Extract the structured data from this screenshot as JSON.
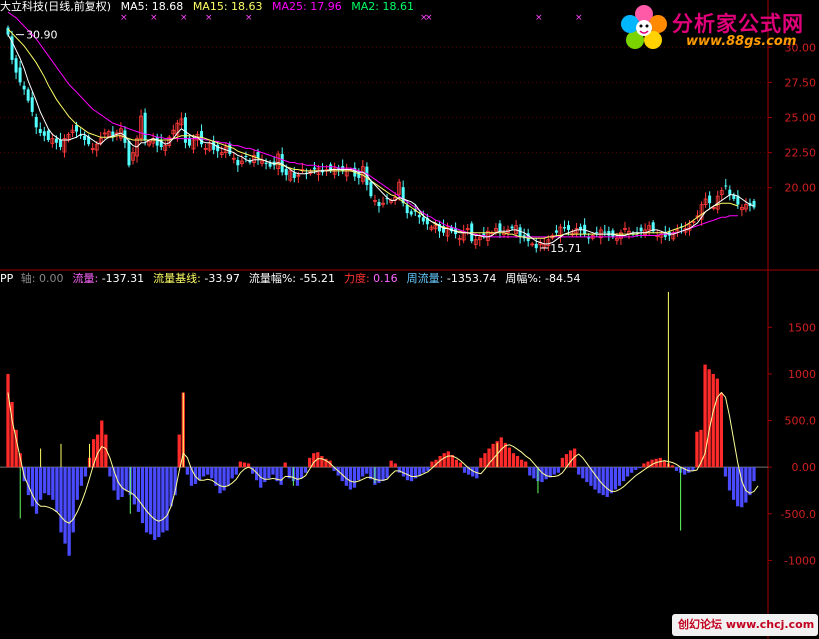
{
  "chart_data": [
    {
      "type": "candlestick",
      "title": "大立科技(日线,前复权)",
      "indicators": [
        {
          "name": "MA5",
          "label": "MA5: 18.68",
          "value": 18.68,
          "color": "#ffffff"
        },
        {
          "name": "MA15",
          "label": "MA15: 18.63",
          "value": 18.63,
          "color": "#ffff66"
        },
        {
          "name": "MA25",
          "label": "MA25: 17.96",
          "value": 17.96,
          "color": "#ff00ff"
        },
        {
          "name": "MA2",
          "label": "MA2: 18.61",
          "value": 18.61,
          "color": "#00ff66"
        }
      ],
      "y_ticks": [
        "30.00",
        "27.50",
        "25.00",
        "22.50",
        "20.00"
      ],
      "ylim": [
        14.5,
        31.8
      ],
      "annotations": [
        {
          "text": "30.90",
          "x": 2,
          "y": 30.9
        },
        {
          "text": "15.71",
          "x": 132,
          "y": 15.71
        }
      ],
      "close": [
        30.9,
        29.1,
        28.2,
        27.5,
        27.0,
        26.2,
        25.4,
        24.3,
        23.9,
        23.7,
        23.4,
        23.5,
        23.2,
        22.9,
        23.5,
        23.8,
        24.1,
        24.0,
        23.7,
        23.4,
        23.1,
        22.8,
        23.1,
        23.5,
        23.9,
        24.0,
        23.6,
        23.9,
        24.2,
        23.2,
        21.6,
        22.5,
        23.5,
        25.1,
        23.4,
        23.3,
        23.5,
        23.0,
        22.9,
        23.0,
        23.6,
        24.1,
        24.6,
        24.9,
        23.2,
        23.0,
        23.4,
        23.8,
        23.1,
        22.8,
        23.2,
        22.7,
        22.6,
        22.5,
        22.9,
        22.4,
        22.1,
        21.6,
        21.9,
        22.2,
        21.8,
        22.3,
        22.1,
        21.9,
        21.7,
        21.5,
        21.6,
        22.4,
        21.1,
        20.9,
        21.2,
        20.7,
        20.9,
        21.3,
        21.0,
        21.2,
        21.3,
        21.4,
        21.1,
        21.3,
        21.2,
        21.4,
        21.3,
        21.2,
        21.4,
        21.3,
        20.8,
        20.7,
        21.5,
        20.2,
        19.4,
        19.1,
        18.7,
        18.9,
        19.2,
        19.1,
        19.3,
        20.4,
        18.9,
        18.2,
        18.1,
        18.3,
        17.9,
        17.6,
        17.4,
        17.2,
        17.3,
        16.9,
        16.8,
        17.2,
        16.9,
        16.7,
        16.4,
        16.9,
        17.1,
        16.2,
        16.3,
        16.5,
        16.6,
        16.9,
        16.8,
        17.1,
        16.9,
        16.8,
        17.0,
        17.1,
        17.3,
        16.5,
        16.4,
        16.2,
        16.0,
        15.7,
        16.1,
        16.0,
        16.3,
        16.6,
        16.8,
        17.2,
        17.1,
        17.0,
        16.9,
        17.1,
        17.0,
        16.7,
        16.4,
        16.6,
        16.8,
        17.0,
        16.8,
        16.6,
        16.5,
        16.4,
        16.8,
        17.1,
        16.9,
        16.7,
        16.8,
        16.9,
        17.0,
        17.3,
        16.9,
        16.6,
        16.7,
        16.5,
        16.6,
        16.8,
        17.0,
        17.2,
        17.1,
        17.4,
        17.6,
        18.0,
        18.8,
        19.2,
        18.9,
        18.6,
        19.4,
        19.8,
        20.1,
        19.5,
        19.2,
        18.8,
        18.6,
        18.8,
        18.7,
        18.6
      ],
      "ma5": [
        30.9,
        30.4,
        29.8,
        29.2,
        28.5,
        27.6,
        26.9,
        26.2,
        25.4,
        24.8,
        24.2,
        23.8,
        23.6,
        23.4,
        23.4,
        23.4,
        23.5,
        23.6,
        23.8,
        23.8,
        23.6,
        23.4,
        23.2,
        23.1,
        23.4,
        23.6,
        23.7,
        23.8,
        23.9,
        23.7,
        23.3,
        23.0,
        22.9,
        23.2,
        23.2,
        23.4,
        23.5,
        23.4,
        23.3,
        23.1,
        23.2,
        23.5,
        23.9,
        24.2,
        24.0,
        23.8,
        23.6,
        23.6,
        23.3,
        23.2,
        23.2,
        23.1,
        22.9,
        22.8,
        22.7,
        22.6,
        22.5,
        22.3,
        22.2,
        22.0,
        21.9,
        22.0,
        22.0,
        22.0,
        21.9,
        21.8,
        21.7,
        21.8,
        21.7,
        21.5,
        21.3,
        21.1,
        21.0,
        21.0,
        21.0,
        21.1,
        21.1,
        21.2,
        21.2,
        21.2,
        21.3,
        21.3,
        21.3,
        21.3,
        21.3,
        21.3,
        21.2,
        21.1,
        21.1,
        20.9,
        20.5,
        20.2,
        19.9,
        19.6,
        19.3,
        19.1,
        19.1,
        19.3,
        19.2,
        19.1,
        19.0,
        18.8,
        18.4,
        18.0,
        17.8,
        17.6,
        17.5,
        17.3,
        17.1,
        17.1,
        17.0,
        16.9,
        16.8,
        16.8,
        16.8,
        16.7,
        16.6,
        16.6,
        16.5,
        16.5,
        16.6,
        16.8,
        16.9,
        16.9,
        16.9,
        17.0,
        17.0,
        16.9,
        16.8,
        16.6,
        16.4,
        16.2,
        16.1,
        16.0,
        16.0,
        16.1,
        16.3,
        16.5,
        16.7,
        16.8,
        16.9,
        17.0,
        17.0,
        17.0,
        16.9,
        16.8,
        16.7,
        16.7,
        16.7,
        16.7,
        16.7,
        16.6,
        16.6,
        16.6,
        16.7,
        16.8,
        16.8,
        16.8,
        16.8,
        16.9,
        17.0,
        17.0,
        16.9,
        16.8,
        16.7,
        16.7,
        16.8,
        16.9,
        17.0,
        17.1,
        17.3,
        17.5,
        17.9,
        18.3,
        18.5,
        18.7,
        18.9,
        19.1,
        19.3,
        19.5,
        19.5,
        19.4,
        19.2,
        19.0,
        18.8,
        18.7
      ],
      "ma15": [
        31.3,
        31.0,
        30.7,
        30.4,
        30.1,
        29.7,
        29.3,
        28.9,
        28.4,
        27.9,
        27.3,
        26.8,
        26.3,
        25.9,
        25.5,
        25.1,
        24.8,
        24.5,
        24.3,
        24.1,
        23.9,
        23.8,
        23.7,
        23.6,
        23.6,
        23.6,
        23.6,
        23.7,
        23.7,
        23.6,
        23.5,
        23.4,
        23.4,
        23.4,
        23.4,
        23.4,
        23.4,
        23.4,
        23.4,
        23.4,
        23.4,
        23.5,
        23.6,
        23.7,
        23.7,
        23.7,
        23.7,
        23.6,
        23.6,
        23.5,
        23.4,
        23.3,
        23.2,
        23.1,
        23.0,
        22.9,
        22.8,
        22.6,
        22.5,
        22.4,
        22.3,
        22.2,
        22.1,
        22.0,
        21.9,
        21.8,
        21.7,
        21.7,
        21.6,
        21.5,
        21.4,
        21.3,
        21.3,
        21.2,
        21.2,
        21.2,
        21.2,
        21.2,
        21.2,
        21.2,
        21.2,
        21.2,
        21.2,
        21.2,
        21.2,
        21.2,
        21.1,
        21.0,
        20.9,
        20.7,
        20.5,
        20.3,
        20.1,
        19.9,
        19.7,
        19.5,
        19.4,
        19.2,
        19.0,
        18.8,
        18.6,
        18.4,
        18.2,
        18.0,
        17.8,
        17.6,
        17.4,
        17.3,
        17.2,
        17.1,
        17.0,
        16.9,
        16.9,
        16.8,
        16.8,
        16.8,
        16.8,
        16.8,
        16.8,
        16.8,
        16.8,
        16.8,
        16.8,
        16.8,
        16.7,
        16.7,
        16.6,
        16.5,
        16.5,
        16.4,
        16.4,
        16.4,
        16.4,
        16.4,
        16.5,
        16.5,
        16.6,
        16.6,
        16.7,
        16.7,
        16.7,
        16.7,
        16.7,
        16.7,
        16.7,
        16.7,
        16.7,
        16.7,
        16.7,
        16.7,
        16.7,
        16.7,
        16.7,
        16.7,
        16.7,
        16.7,
        16.7,
        16.8,
        16.8,
        16.8,
        16.8,
        16.8,
        16.8,
        16.8,
        16.9,
        17.0,
        17.1,
        17.2,
        17.3,
        17.5,
        17.7,
        17.9,
        18.1,
        18.3,
        18.5,
        18.7,
        18.8,
        18.9,
        18.9,
        18.9,
        18.8,
        18.7
      ],
      "ma25": [
        32.5,
        32.3,
        32.1,
        31.8,
        31.5,
        31.2,
        30.9,
        30.6,
        30.2,
        29.8,
        29.4,
        29.0,
        28.6,
        28.2,
        27.8,
        27.4,
        27.1,
        26.8,
        26.5,
        26.2,
        25.9,
        25.6,
        25.4,
        25.2,
        25.0,
        24.8,
        24.6,
        24.5,
        24.4,
        24.3,
        24.2,
        24.1,
        24.0,
        23.9,
        23.8,
        23.8,
        23.7,
        23.6,
        23.6,
        23.5,
        23.5,
        23.5,
        23.5,
        23.5,
        23.5,
        23.5,
        23.5,
        23.5,
        23.5,
        23.4,
        23.4,
        23.3,
        23.3,
        23.2,
        23.2,
        23.1,
        23.0,
        23.0,
        22.9,
        22.8,
        22.8,
        22.7,
        22.6,
        22.5,
        22.4,
        22.3,
        22.2,
        22.1,
        22.0,
        21.9,
        21.8,
        21.8,
        21.7,
        21.7,
        21.6,
        21.6,
        21.6,
        21.5,
        21.5,
        21.5,
        21.5,
        21.5,
        21.4,
        21.4,
        21.4,
        21.4,
        21.3,
        21.2,
        21.1,
        21.0,
        20.8,
        20.6,
        20.4,
        20.2,
        20.0,
        19.8,
        19.6,
        19.4,
        19.2,
        19.0,
        18.8,
        18.6,
        18.4,
        18.2,
        18.0,
        17.9,
        17.7,
        17.6,
        17.4,
        17.3,
        17.2,
        17.1,
        17.0,
        16.9,
        16.8,
        16.7,
        16.7,
        16.6,
        16.6,
        16.5,
        16.5,
        16.5,
        16.5,
        16.5,
        16.5,
        16.5,
        16.5,
        16.5,
        16.5,
        16.5,
        16.5,
        16.5,
        16.5,
        16.5,
        16.5,
        16.5,
        16.5,
        16.5,
        16.5,
        16.5,
        16.5,
        16.5,
        16.5,
        16.5,
        16.5,
        16.5,
        16.5,
        16.5,
        16.5,
        16.5,
        16.5,
        16.5,
        16.5,
        16.5,
        16.5,
        16.5,
        16.6,
        16.6,
        16.6,
        16.6,
        16.6,
        16.6,
        16.7,
        16.7,
        16.7,
        16.8,
        16.8,
        16.9,
        17.0,
        17.1,
        17.2,
        17.3,
        17.4,
        17.5,
        17.6,
        17.7,
        17.8,
        17.9,
        17.9,
        18.0,
        18.0,
        18.0
      ]
    },
    {
      "type": "bar",
      "prefix": "PP",
      "stats": [
        {
          "label": "轴",
          "value": "0.00",
          "label_color": "#888888",
          "value_color": "#888888"
        },
        {
          "label": "流量",
          "value": "-137.31",
          "label_color": "#ff66ff",
          "value_color": "#ffffff"
        },
        {
          "label": "流量基线",
          "value": "-33.97",
          "label_color": "#ffff66",
          "value_color": "#ffffff"
        },
        {
          "label": "流量幅%",
          "value": "-55.21",
          "label_color": "#ffffff",
          "value_color": "#ffffff"
        },
        {
          "label": "力度",
          "value": "0.16",
          "label_color": "#ff3333",
          "value_color": "#ff66ff"
        },
        {
          "label": "周流量",
          "value": "-1353.74",
          "label_color": "#66ccff",
          "value_color": "#ffffff"
        },
        {
          "label": "周幅%",
          "value": "-84.54",
          "label_color": "#ffffff",
          "value_color": "#ffffff"
        }
      ],
      "y_ticks": [
        "1500",
        "1000",
        "500.0",
        "0.00",
        "-500.0",
        "-1000"
      ],
      "ylim": [
        -1800,
        1900
      ],
      "values": [
        1000,
        700,
        400,
        150,
        -150,
        -300,
        -420,
        -500,
        -350,
        -280,
        -300,
        -350,
        -480,
        -700,
        -820,
        -950,
        -700,
        -350,
        -200,
        -100,
        100,
        300,
        350,
        500,
        350,
        -100,
        -250,
        -350,
        -320,
        -250,
        -300,
        -400,
        -480,
        -600,
        -700,
        -720,
        -780,
        -750,
        -700,
        -680,
        -420,
        -300,
        350,
        800,
        -80,
        -200,
        -180,
        -140,
        -100,
        -80,
        -120,
        -200,
        -280,
        -250,
        -200,
        -120,
        -80,
        60,
        50,
        40,
        -70,
        -140,
        -220,
        -160,
        -120,
        -80,
        -150,
        -190,
        50,
        -120,
        -150,
        -200,
        -120,
        -60,
        100,
        150,
        160,
        120,
        90,
        70,
        -40,
        -90,
        -150,
        -200,
        -240,
        -220,
        -140,
        -100,
        -70,
        -130,
        -190,
        -170,
        -150,
        -120,
        70,
        40,
        -60,
        -100,
        -140,
        -150,
        -120,
        -90,
        -60,
        -40,
        60,
        80,
        120,
        150,
        170,
        130,
        80,
        50,
        -60,
        -80,
        -100,
        -120,
        100,
        150,
        200,
        250,
        280,
        320,
        260,
        210,
        150,
        120,
        80,
        60,
        -90,
        -120,
        -150,
        -160,
        -130,
        -110,
        -80,
        -60,
        100,
        140,
        180,
        200,
        -80,
        -120,
        -160,
        -200,
        -240,
        -280,
        -300,
        -320,
        -280,
        -240,
        -200,
        -150,
        -100,
        -60,
        -30,
        -10,
        40,
        60,
        80,
        90,
        100,
        70,
        40,
        20,
        -40,
        -60,
        -80,
        -60,
        -40,
        380,
        400,
        1100,
        1050,
        1000,
        950,
        800,
        -100,
        -250,
        -350,
        -420,
        -430,
        -380,
        -300,
        -150
      ],
      "flow_line": [
        800,
        500,
        300,
        100,
        -100,
        -200,
        -300,
        -380,
        -420,
        -420,
        -430,
        -450,
        -480,
        -530,
        -580,
        -600,
        -560,
        -480,
        -380,
        -260,
        -120,
        30,
        150,
        220,
        200,
        100,
        -40,
        -160,
        -220,
        -250,
        -270,
        -300,
        -350,
        -410,
        -470,
        -520,
        -560,
        -580,
        -560,
        -520,
        -420,
        -260,
        -40,
        150,
        100,
        -20,
        -100,
        -140,
        -140,
        -130,
        -140,
        -170,
        -200,
        -210,
        -200,
        -170,
        -130,
        -60,
        -20,
        0,
        -20,
        -60,
        -110,
        -130,
        -130,
        -120,
        -130,
        -140,
        -100,
        -100,
        -110,
        -130,
        -120,
        -90,
        -20,
        50,
        90,
        90,
        70,
        40,
        0,
        -40,
        -80,
        -120,
        -150,
        -160,
        -150,
        -130,
        -110,
        -110,
        -130,
        -140,
        -140,
        -130,
        -80,
        -40,
        -40,
        -60,
        -80,
        -100,
        -100,
        -90,
        -70,
        -50,
        -10,
        30,
        70,
        100,
        120,
        120,
        100,
        70,
        30,
        -10,
        -40,
        -60,
        -70,
        -20,
        40,
        90,
        140,
        190,
        230,
        240,
        220,
        190,
        160,
        120,
        90,
        40,
        -10,
        -60,
        -90,
        -100,
        -100,
        -90,
        -60,
        0,
        60,
        110,
        140,
        100,
        40,
        -20,
        -80,
        -140,
        -190,
        -230,
        -260,
        -260,
        -240,
        -210,
        -170,
        -130,
        -90,
        -60,
        -30,
        0,
        30,
        50,
        60,
        70,
        60,
        50,
        30,
        0,
        -20,
        -40,
        -40,
        -30,
        50,
        150,
        400,
        600,
        750,
        800,
        750,
        550,
        300,
        50,
        -150,
        -250,
        -280,
        -260,
        -200
      ],
      "spikes": [
        {
          "i": 3,
          "v": -550
        },
        {
          "i": 8,
          "v": 200
        },
        {
          "i": 13,
          "v": 250
        },
        {
          "i": 20,
          "v": 250
        },
        {
          "i": 30,
          "v": -500
        },
        {
          "i": 43,
          "v": 800
        },
        {
          "i": 70,
          "v": -200
        },
        {
          "i": 90,
          "v": -170
        },
        {
          "i": 120,
          "v": 260
        },
        {
          "i": 130,
          "v": -280
        },
        {
          "i": 162,
          "v": 1880
        },
        {
          "i": 165,
          "v": -680
        }
      ]
    }
  ],
  "watermark_top": {
    "brand": "分析家公式网",
    "url": "www.88gs.com"
  },
  "watermark_bottom": {
    "text": "创幻论坛 www.chcj.com"
  }
}
